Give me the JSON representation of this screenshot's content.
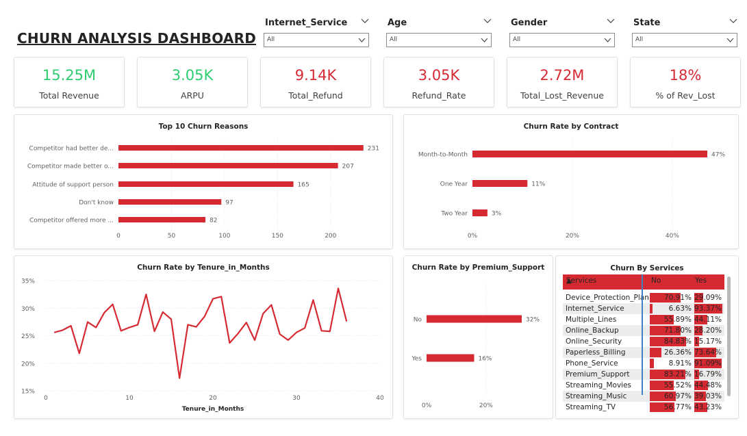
{
  "dashboard": {
    "title": "CHURN ANALYSIS DASHBOARD"
  },
  "filters": [
    {
      "label": "Internet_Service",
      "value": "All"
    },
    {
      "label": "Age",
      "value": "All"
    },
    {
      "label": "Gender",
      "value": "All"
    },
    {
      "label": "State",
      "value": "All"
    }
  ],
  "kpis": [
    {
      "value": "15.25M",
      "label": "Total Revenue",
      "color": "#2ecc71"
    },
    {
      "value": "3.05K",
      "label": "ARPU",
      "color": "#2ecc71"
    },
    {
      "value": "9.14K",
      "label": "Total_Refund",
      "color": "#d62a33"
    },
    {
      "value": "3.05K",
      "label": "Refund_Rate",
      "color": "#d62a33"
    },
    {
      "value": "2.72M",
      "label": "Total_Lost_Revenue",
      "color": "#d62a33"
    },
    {
      "value": "18%",
      "label": "% of Rev_Lost",
      "color": "#d62a33"
    }
  ],
  "accent_color": "#d62a33",
  "chart_data": [
    {
      "id": "top_reasons",
      "type": "bar",
      "orientation": "horizontal",
      "title": "Top 10 Churn Reasons",
      "categories": [
        "Competitor had better de...",
        "Competitor made better o...",
        "Attitude of support person",
        "Don't know",
        "Competitor offered more ..."
      ],
      "values": [
        231,
        207,
        165,
        97,
        82
      ],
      "data_labels": [
        "231",
        "207",
        "165",
        "97",
        "82"
      ],
      "xlim": [
        0,
        235
      ],
      "xticks": [
        0,
        50,
        100,
        150,
        200
      ],
      "xtick_labels": [
        "0",
        "50",
        "100",
        "150",
        "200"
      ],
      "grid": true
    },
    {
      "id": "contract",
      "type": "bar",
      "orientation": "horizontal",
      "title": "Churn Rate by Contract",
      "categories": [
        "Month-to-Month",
        "One Year",
        "Two Year"
      ],
      "values": [
        47,
        11,
        3
      ],
      "data_labels": [
        "47%",
        "11%",
        "3%"
      ],
      "xlim": [
        0,
        47
      ],
      "xticks": [
        0,
        20,
        40
      ],
      "xtick_labels": [
        "0%",
        "20%",
        "40%"
      ],
      "grid": true
    },
    {
      "id": "tenure",
      "type": "line",
      "title": "Churn Rate by Tenure_in_Months",
      "xlabel": "Tenure_in_Months",
      "x": [
        1,
        2,
        3,
        4,
        5,
        6,
        7,
        8,
        9,
        10,
        11,
        12,
        13,
        14,
        15,
        16,
        17,
        18,
        19,
        20,
        21,
        22,
        23,
        24,
        25,
        26,
        27,
        28,
        29,
        30,
        31,
        32,
        33,
        34,
        35,
        36
      ],
      "y": [
        25.6,
        26.0,
        26.8,
        21.8,
        27.5,
        26.5,
        29.2,
        30.7,
        25.9,
        26.5,
        27.0,
        32.5,
        25.8,
        29.3,
        28.0,
        17.3,
        27.0,
        26.6,
        28.5,
        31.7,
        32.1,
        23.7,
        25.4,
        27.4,
        24.2,
        29.0,
        30.6,
        25.3,
        24.2,
        25.6,
        26.4,
        31.5,
        25.9,
        25.8,
        33.6,
        27.6
      ],
      "ylim": [
        15,
        35
      ],
      "yticks": [
        15,
        20,
        25,
        30,
        35
      ],
      "ytick_labels": [
        "15%",
        "20%",
        "25%",
        "30%",
        "35%"
      ],
      "xlim": [
        0,
        40
      ],
      "xticks": [
        0,
        10,
        20,
        30,
        40
      ],
      "xtick_labels": [
        "0",
        "10",
        "20",
        "30",
        "40"
      ],
      "grid": true
    },
    {
      "id": "premium",
      "type": "bar",
      "orientation": "horizontal",
      "title": "Churn Rate by Premium_Support",
      "categories": [
        "No",
        "Yes"
      ],
      "values": [
        32,
        16
      ],
      "data_labels": [
        "32%",
        "16%"
      ],
      "xlim": [
        0,
        32
      ],
      "xticks": [
        0,
        20
      ],
      "xtick_labels": [
        "0%",
        "20%"
      ],
      "grid": true
    },
    {
      "id": "services",
      "type": "table",
      "title": "Churn By Services",
      "columns": [
        "Services",
        "No",
        "Yes"
      ],
      "rows": [
        {
          "service": "Device_Protection_Plan",
          "no": 70.91,
          "no_label": "70.91%",
          "yes": 29.09,
          "yes_label": "29.09%"
        },
        {
          "service": "Internet_Service",
          "no": 6.63,
          "no_label": "6.63%",
          "yes": 93.37,
          "yes_label": "93.37%"
        },
        {
          "service": "Multiple_Lines",
          "no": 55.89,
          "no_label": "55.89%",
          "yes": 44.11,
          "yes_label": "44.11%"
        },
        {
          "service": "Online_Backup",
          "no": 71.8,
          "no_label": "71.80%",
          "yes": 28.2,
          "yes_label": "28.20%"
        },
        {
          "service": "Online_Security",
          "no": 84.83,
          "no_label": "84.83%",
          "yes": 15.17,
          "yes_label": "15.17%"
        },
        {
          "service": "Paperless_Billing",
          "no": 26.36,
          "no_label": "26.36%",
          "yes": 73.64,
          "yes_label": "73.64%"
        },
        {
          "service": "Phone_Service",
          "no": 8.91,
          "no_label": "8.91%",
          "yes": 91.09,
          "yes_label": "91.09%"
        },
        {
          "service": "Premium_Support",
          "no": 83.21,
          "no_label": "83.21%",
          "yes": 16.79,
          "yes_label": "16.79%"
        },
        {
          "service": "Streaming_Movies",
          "no": 55.52,
          "no_label": "55.52%",
          "yes": 44.48,
          "yes_label": "44.48%"
        },
        {
          "service": "Streaming_Music",
          "no": 60.97,
          "no_label": "60.97%",
          "yes": 39.03,
          "yes_label": "39.03%"
        },
        {
          "service": "Streaming_TV",
          "no": 56.77,
          "no_label": "56.77%",
          "yes": 43.23,
          "yes_label": "43.23%"
        }
      ]
    }
  ]
}
